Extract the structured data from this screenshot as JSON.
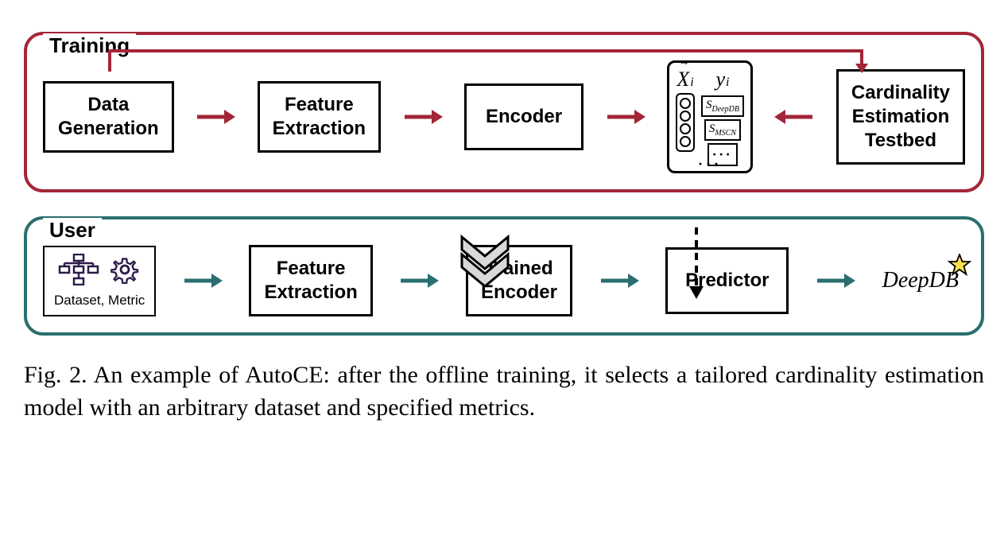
{
  "training": {
    "label": "Training",
    "boxes": {
      "data_gen": "Data\nGeneration",
      "feat_ext": "Feature\nExtraction",
      "encoder": "Encoder",
      "testbed": "Cardinality\nEstimation\nTestbed"
    },
    "xy": {
      "x_label_main": "X",
      "x_label_sub": "i",
      "y_label_main": "y",
      "y_label_sub": "i",
      "s1_main": "S",
      "s1_sub": "DeepDB",
      "s2_main": "S",
      "s2_sub": "MSCN"
    }
  },
  "user": {
    "label": "User",
    "input_label": "Dataset, Metric",
    "boxes": {
      "feat_ext": "Feature\nExtraction",
      "trained_enc": "Trained\nEncoder",
      "predictor": "Predictor"
    },
    "output": "DeepDB"
  },
  "caption": "Fig. 2.  An example of AutoCE: after the offline training, it selects a tailored cardinality estimation model with an arbitrary dataset and specified metrics."
}
